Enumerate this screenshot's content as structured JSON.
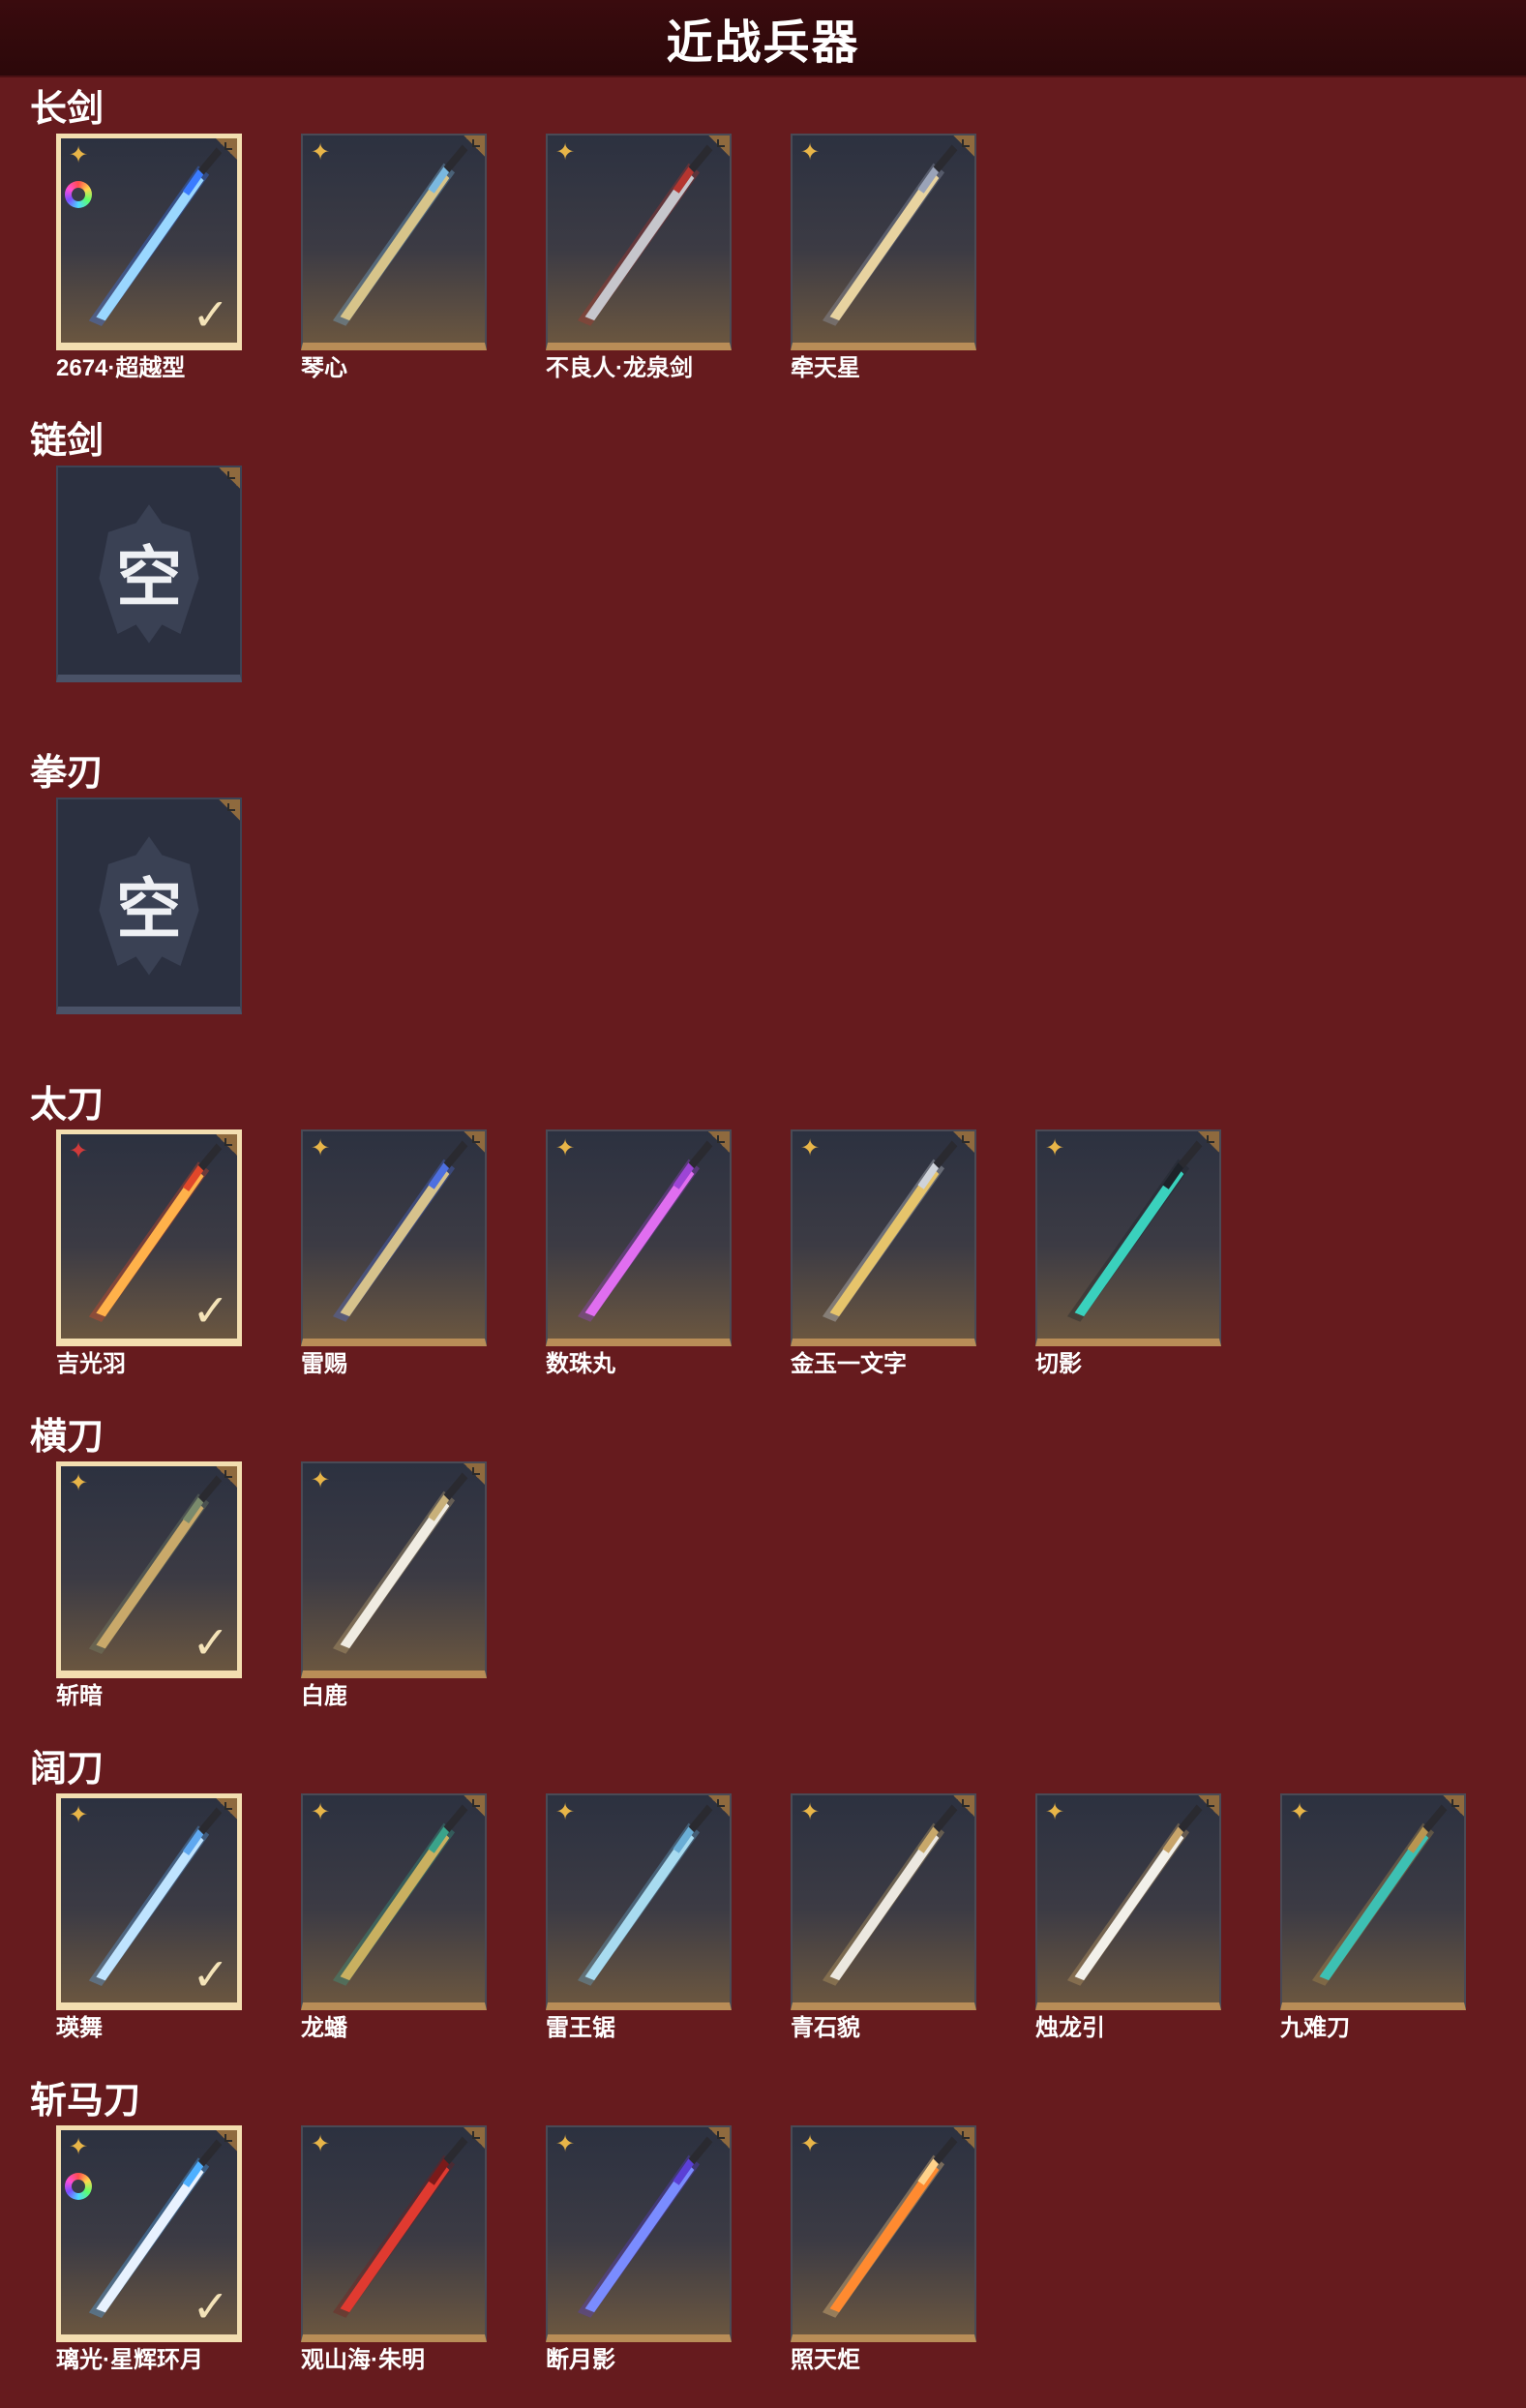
{
  "header": {
    "title": "近战兵器"
  },
  "empty_text": "空",
  "sections": [
    {
      "title": "长剑",
      "items": [
        {
          "name": "2674·超越型",
          "equipped": true,
          "icons": [
            "rarity-icon",
            "color-wheel-icon",
            "check-icon"
          ],
          "colors": [
            "#9ad7ff",
            "#3a7bff"
          ]
        },
        {
          "name": "琴心",
          "equipped": false,
          "icons": [
            "rarity-icon"
          ],
          "colors": [
            "#d7c48a",
            "#7ab8e0"
          ]
        },
        {
          "name": "不良人·龙泉剑",
          "equipped": false,
          "icons": [
            "rarity-icon"
          ],
          "colors": [
            "#c6c6cc",
            "#b5352f"
          ]
        },
        {
          "name": "牵天星",
          "equipped": false,
          "icons": [
            "rarity-icon"
          ],
          "colors": [
            "#e8d3a0",
            "#9aa3b8"
          ]
        }
      ]
    },
    {
      "title": "链剑",
      "items": [
        {
          "name": "",
          "empty": true
        }
      ]
    },
    {
      "title": "拳刃",
      "items": [
        {
          "name": "",
          "empty": true
        }
      ]
    },
    {
      "title": "太刀",
      "items": [
        {
          "name": "吉光羽",
          "equipped": true,
          "icons": [
            "red-rarity-icon",
            "check-icon"
          ],
          "colors": [
            "#ffb14a",
            "#e0472a"
          ]
        },
        {
          "name": "雷赐",
          "equipped": false,
          "icons": [
            "rarity-icon"
          ],
          "colors": [
            "#d6c28c",
            "#4d6fe0"
          ]
        },
        {
          "name": "数珠丸",
          "equipped": false,
          "icons": [
            "rarity-icon"
          ],
          "colors": [
            "#e06ef0",
            "#9d45d6"
          ]
        },
        {
          "name": "金玉一文字",
          "equipped": false,
          "icons": [
            "rarity-icon"
          ],
          "colors": [
            "#e6c46b",
            "#cfd3da"
          ]
        },
        {
          "name": "切影",
          "equipped": false,
          "icons": [
            "rarity-icon"
          ],
          "colors": [
            "#3ad1bd",
            "#1e2229"
          ]
        }
      ]
    },
    {
      "title": "横刀",
      "items": [
        {
          "name": "斩暗",
          "equipped": true,
          "icons": [
            "rarity-icon",
            "check-icon"
          ],
          "colors": [
            "#c9a96a",
            "#7a8a6c"
          ]
        },
        {
          "name": "白鹿",
          "equipped": false,
          "icons": [
            "rarity-icon"
          ],
          "colors": [
            "#f0ece2",
            "#c8b07a"
          ]
        }
      ]
    },
    {
      "title": "阔刀",
      "items": [
        {
          "name": "瑛舞",
          "equipped": true,
          "icons": [
            "rarity-icon",
            "check-icon"
          ],
          "colors": [
            "#bfe4ff",
            "#5fa8f0"
          ]
        },
        {
          "name": "龙蟠",
          "equipped": false,
          "icons": [
            "rarity-icon"
          ],
          "colors": [
            "#c9b060",
            "#3aa38a"
          ]
        },
        {
          "name": "雷王锯",
          "equipped": false,
          "icons": [
            "rarity-icon"
          ],
          "colors": [
            "#a8dbf0",
            "#6aaed6"
          ]
        },
        {
          "name": "青石貌",
          "equipped": false,
          "icons": [
            "rarity-icon"
          ],
          "colors": [
            "#ece8e0",
            "#c8a86a"
          ]
        },
        {
          "name": "烛龙引",
          "equipped": false,
          "icons": [
            "rarity-icon"
          ],
          "colors": [
            "#f2f0ea",
            "#c8a46a"
          ]
        },
        {
          "name": "九难刀",
          "equipped": false,
          "icons": [
            "rarity-icon"
          ],
          "colors": [
            "#3dc0b3",
            "#b89550"
          ]
        }
      ]
    },
    {
      "title": "斩马刀",
      "items": [
        {
          "name": "璃光·星辉环月",
          "equipped": true,
          "icons": [
            "rarity-icon",
            "color-wheel-icon",
            "check-icon"
          ],
          "colors": [
            "#e8f2ff",
            "#4fb0ff"
          ]
        },
        {
          "name": "观山海·朱明",
          "equipped": false,
          "icons": [
            "rarity-icon"
          ],
          "colors": [
            "#e03a30",
            "#7a1a1a"
          ]
        },
        {
          "name": "断月影",
          "equipped": false,
          "icons": [
            "rarity-icon"
          ],
          "colors": [
            "#7a8cff",
            "#5b3fd6"
          ]
        },
        {
          "name": "照天炬",
          "equipped": false,
          "icons": [
            "rarity-icon"
          ],
          "colors": [
            "#ff8a30",
            "#ffd28a"
          ]
        }
      ]
    }
  ]
}
